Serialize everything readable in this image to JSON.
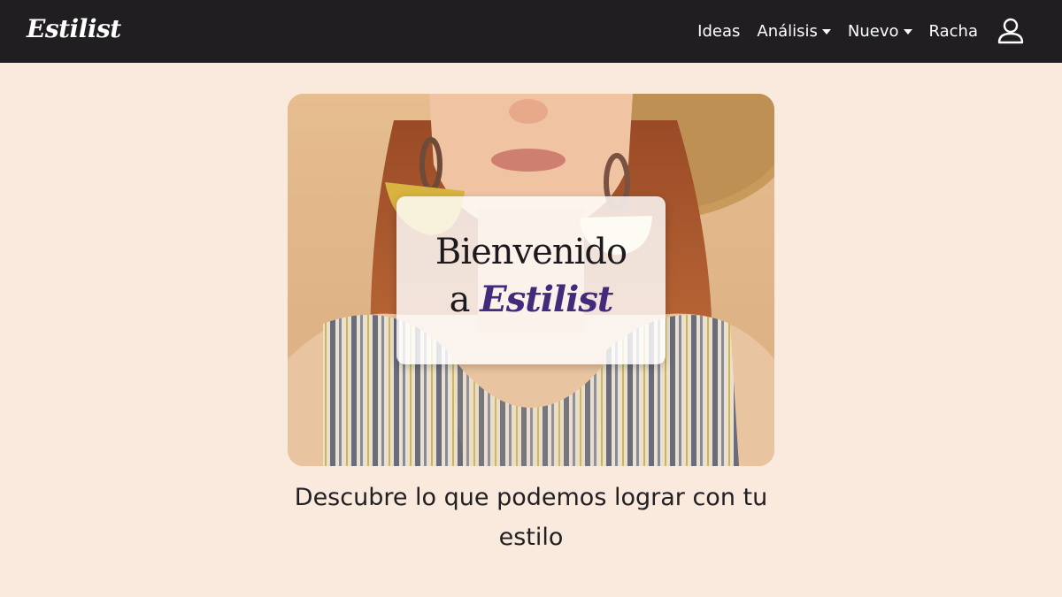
{
  "navbar": {
    "brand": "Estilist",
    "links": [
      {
        "label": "Ideas",
        "dropdown": false
      },
      {
        "label": "Análisis",
        "dropdown": true
      },
      {
        "label": "Nuevo",
        "dropdown": true
      },
      {
        "label": "Racha",
        "dropdown": false
      }
    ],
    "user_icon": "user-icon"
  },
  "hero": {
    "image_icon": "hero-photo",
    "welcome_prefix": "Bienvenido",
    "welcome_a": "a",
    "welcome_brand": "Estilist"
  },
  "tagline": "Descubre lo que podemos lograr con tu estilo",
  "colors": {
    "background": "#fae9dd",
    "navbar": "#201e21",
    "brand_accent": "#432a7a"
  }
}
